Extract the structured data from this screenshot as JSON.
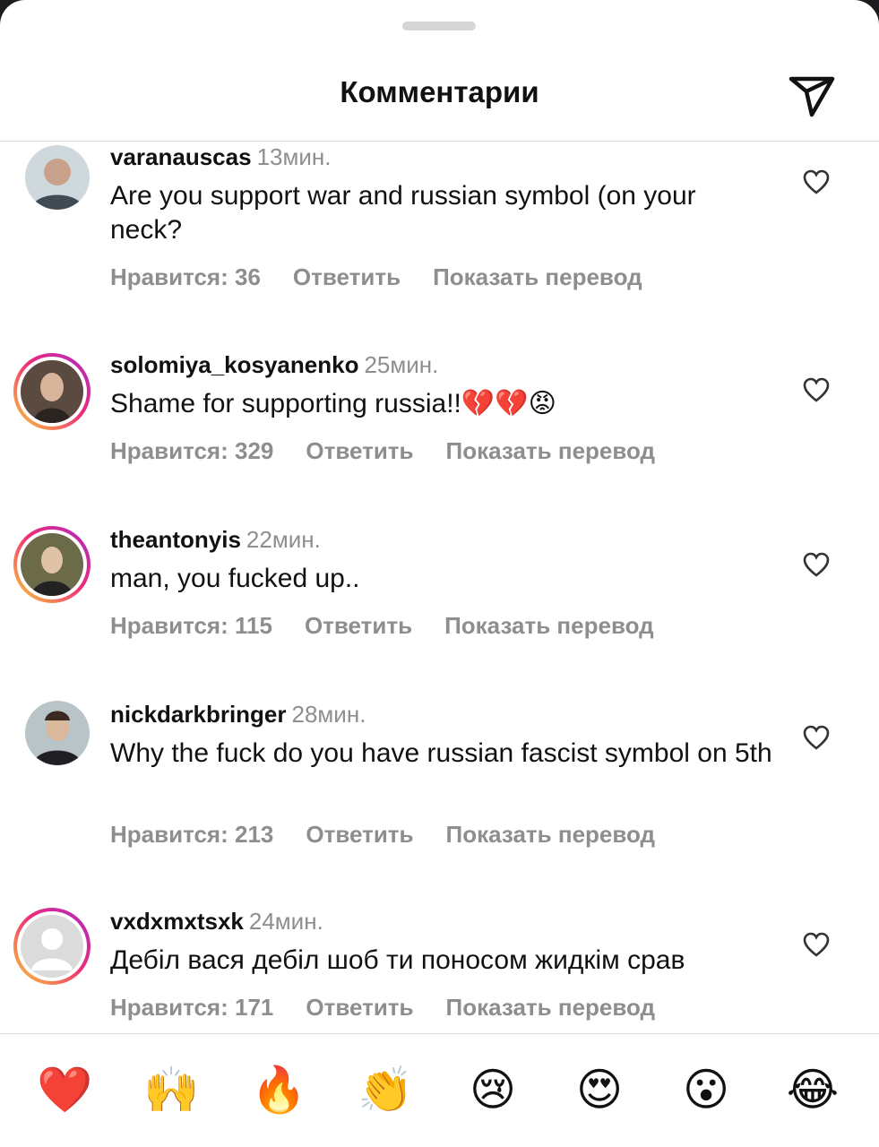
{
  "header": {
    "title": "Комментарии"
  },
  "comments": [
    {
      "username": "varanauscas",
      "time": "13мин.",
      "text": "Are you support war and russian symbol (on your neck?",
      "likes": "Нравится: 36",
      "reply": "Ответить",
      "translate": "Показать перевод"
    },
    {
      "username": "solomiya_kosyanenko",
      "time": "25мин.",
      "text": "Shame for supporting russia!!💔💔😡",
      "likes": "Нравится: 329",
      "reply": "Ответить",
      "translate": "Показать перевод"
    },
    {
      "username": "theantonyis",
      "time": "22мин.",
      "text": "man, you fucked up..",
      "likes": "Нравится: 115",
      "reply": "Ответить",
      "translate": "Показать перевод"
    },
    {
      "username": "nickdarkbringer",
      "time": "28мин.",
      "text": "Why the fuck do you have russian fascist symbol on 5th",
      "likes": "Нравится: 213",
      "reply": "Ответить",
      "translate": "Показать перевод"
    },
    {
      "username": "vxdxmxtsxk",
      "time": "24мин.",
      "text": "Дебіл вася дебіл шоб ти поносом жидкім срав",
      "likes": "Нравится: 171",
      "reply": "Ответить",
      "translate": "Показать перевод"
    }
  ],
  "reactions": [
    "❤️",
    "🙌",
    "🔥",
    "👏",
    "😢",
    "😍",
    "😮",
    "😂"
  ]
}
